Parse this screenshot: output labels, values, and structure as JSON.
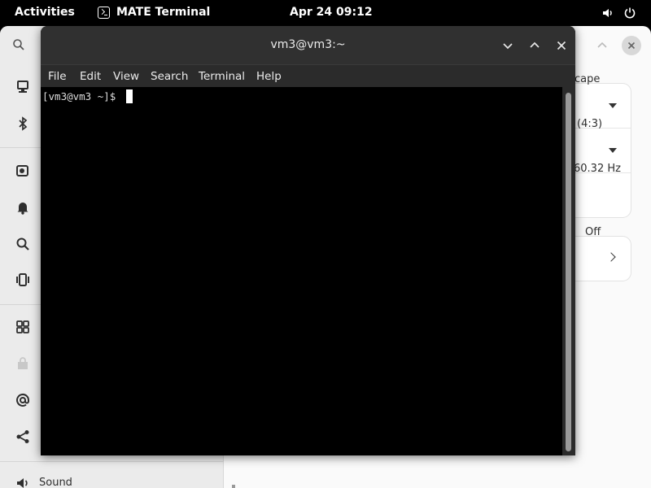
{
  "topbar": {
    "activities": "Activities",
    "app_name": "MATE Terminal",
    "app_icon": "terminal-icon",
    "date": "Apr 24",
    "time": "09:12",
    "tray": [
      "volume-icon",
      "power-icon"
    ]
  },
  "settings": {
    "sidebar": {
      "icons": [
        "display-icon",
        "bluetooth-icon",
        "background-icon",
        "notifications-icon",
        "search-icon",
        "multitasking-icon",
        "apps-icon",
        "privacy-icon",
        "online-accounts-icon",
        "sharing-icon",
        "sound-icon"
      ],
      "sound_label": "Sound"
    },
    "panel": {
      "orientation_value": "cape",
      "resolution_value": "(4:3)",
      "refresh_rate_value": "60.32 Hz",
      "night_light_value": "Off"
    }
  },
  "terminal": {
    "title": "vm3@vm3:~",
    "menu": [
      "File",
      "Edit",
      "View",
      "Search",
      "Terminal",
      "Help"
    ],
    "prompt": "[vm3@vm3 ~]$ "
  },
  "colors": {
    "topbar_bg": "#000000",
    "terminal_titlebar": "#303030",
    "terminal_bg": "#000000",
    "settings_bg": "#fafafa",
    "sidebar_bg": "#ebebeb"
  }
}
